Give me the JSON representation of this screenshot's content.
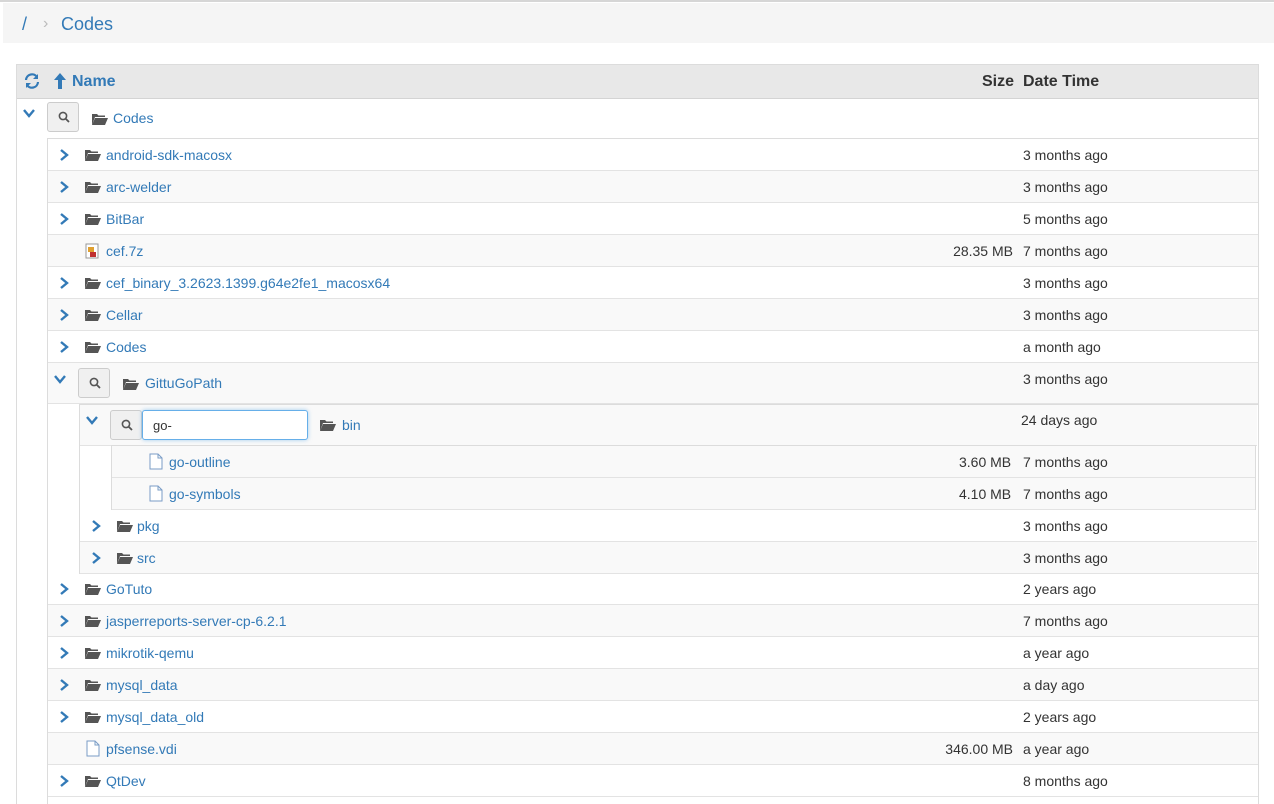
{
  "breadcrumb": {
    "root": "/",
    "separator": ">",
    "current": "Codes"
  },
  "header": {
    "name": "Name",
    "size": "Size",
    "datetime": "Date Time"
  },
  "root": {
    "name": "Codes"
  },
  "rows": [
    {
      "name": "android-sdk-macosx",
      "size": "",
      "date": "3 months ago",
      "type": "folder"
    },
    {
      "name": "arc-welder",
      "size": "",
      "date": "3 months ago",
      "type": "folder"
    },
    {
      "name": "BitBar",
      "size": "",
      "date": "5 months ago",
      "type": "folder"
    },
    {
      "name": "cef.7z",
      "size": "28.35 MB",
      "date": "7 months ago",
      "type": "archive"
    },
    {
      "name": "cef_binary_3.2623.1399.g64e2fe1_macosx64",
      "size": "",
      "date": "3 months ago",
      "type": "folder"
    },
    {
      "name": "Cellar",
      "size": "",
      "date": "3 months ago",
      "type": "folder"
    },
    {
      "name": "Codes",
      "size": "",
      "date": "a month ago",
      "type": "folder"
    }
  ],
  "gittu": {
    "name": "GittuGoPath",
    "date": "3 months ago",
    "bin": {
      "name": "bin",
      "date": "24 days ago",
      "filter_value": "go-",
      "files": [
        {
          "name": "go-outline",
          "size": "3.60 MB",
          "date": "7 months ago"
        },
        {
          "name": "go-symbols",
          "size": "4.10 MB",
          "date": "7 months ago"
        }
      ]
    },
    "subs": [
      {
        "name": "pkg",
        "date": "3 months ago"
      },
      {
        "name": "src",
        "date": "3 months ago"
      }
    ]
  },
  "rows_after": [
    {
      "name": "GoTuto",
      "size": "",
      "date": "2 years ago",
      "type": "folder"
    },
    {
      "name": "jasperreports-server-cp-6.2.1",
      "size": "",
      "date": "7 months ago",
      "type": "folder"
    },
    {
      "name": "mikrotik-qemu",
      "size": "",
      "date": "a year ago",
      "type": "folder"
    },
    {
      "name": "mysql_data",
      "size": "",
      "date": "a day ago",
      "type": "folder"
    },
    {
      "name": "mysql_data_old",
      "size": "",
      "date": "2 years ago",
      "type": "folder"
    },
    {
      "name": "pfsense.vdi",
      "size": "346.00 MB",
      "date": "a year ago",
      "type": "file"
    },
    {
      "name": "QtDev",
      "size": "",
      "date": "8 months ago",
      "type": "folder"
    }
  ],
  "colors": {
    "link": "#337ab7",
    "header_bg": "#e8e8e8",
    "breadcrumb_bg": "#f5f5f5"
  }
}
